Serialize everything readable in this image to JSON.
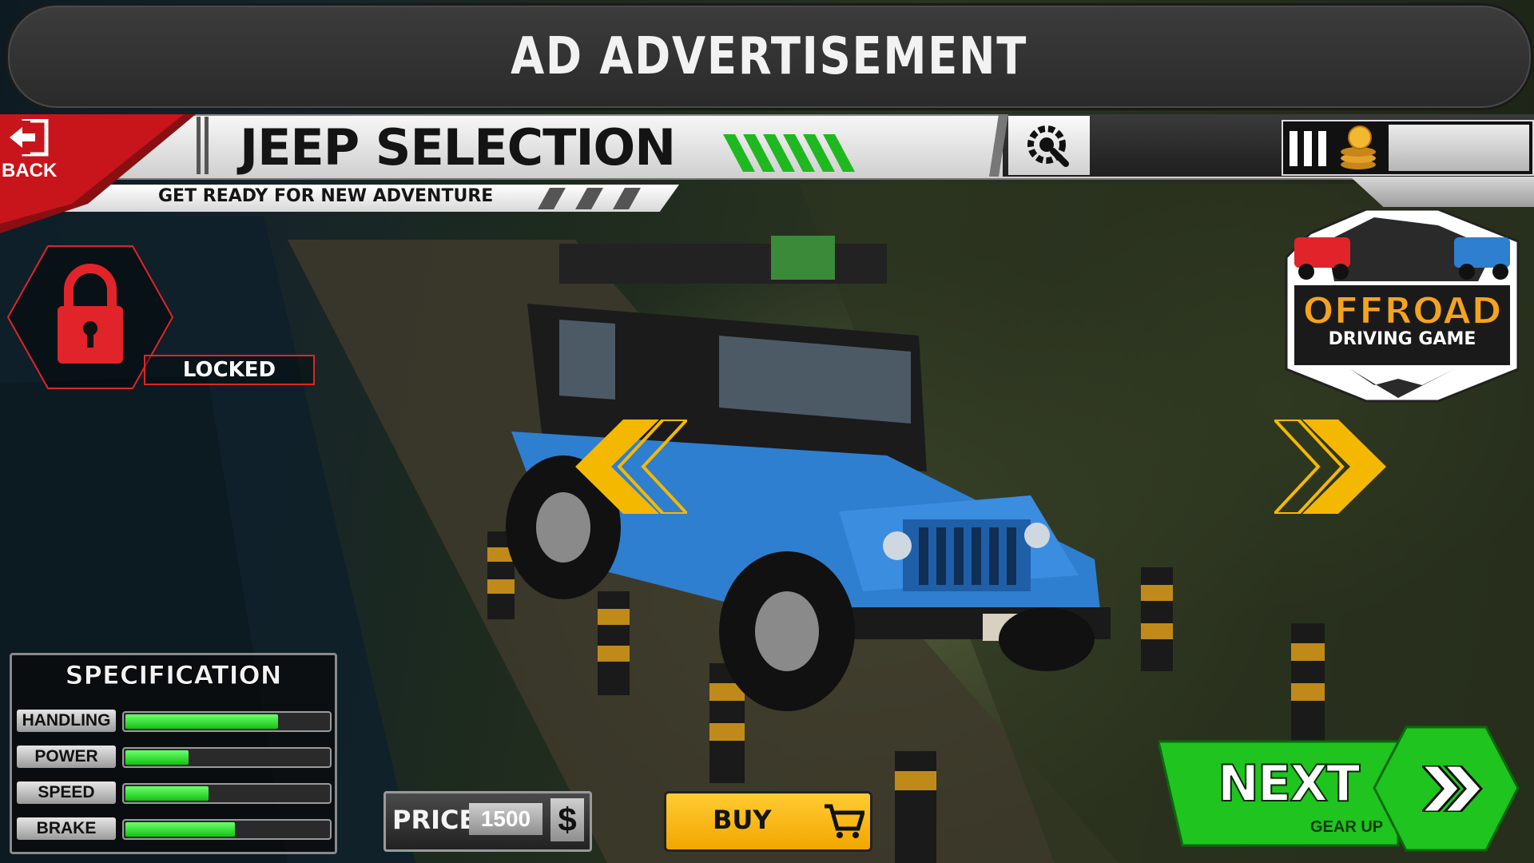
{
  "ad": {
    "text": "AD ADVERTISEMENT"
  },
  "header": {
    "back_label": "BACK",
    "title": "JEEP SELECTION",
    "subtitle": "GET READY FOR NEW ADVENTURE"
  },
  "coins": {
    "value": ""
  },
  "lock": {
    "label": "LOCKED"
  },
  "logo": {
    "title": "OFFROAD",
    "subtitle": "DRIVING GAME"
  },
  "specs": {
    "title": "SPECIFICATION",
    "items": [
      {
        "label": "HANDLING",
        "level": 0.75
      },
      {
        "label": "POWER",
        "level": 0.31
      },
      {
        "label": "SPEED",
        "level": 0.41
      },
      {
        "label": "BRAKE",
        "level": 0.54
      }
    ]
  },
  "price": {
    "label": "PRICE",
    "value": "1500",
    "currency": "$"
  },
  "buy": {
    "label": "BUY"
  },
  "next": {
    "label": "NEXT",
    "sub": "GEAR UP"
  },
  "colors": {
    "accent_green": "#1fc41f",
    "accent_yellow": "#f5b800",
    "lock_red": "#e0242a",
    "vehicle_blue": "#2f7fd0"
  },
  "icons": [
    "back-icon",
    "gear-wrench-icon",
    "coin-stack-icon",
    "padlock-icon",
    "chevron-left-double-icon",
    "chevron-right-double-icon",
    "cart-icon",
    "dollar-icon"
  ]
}
